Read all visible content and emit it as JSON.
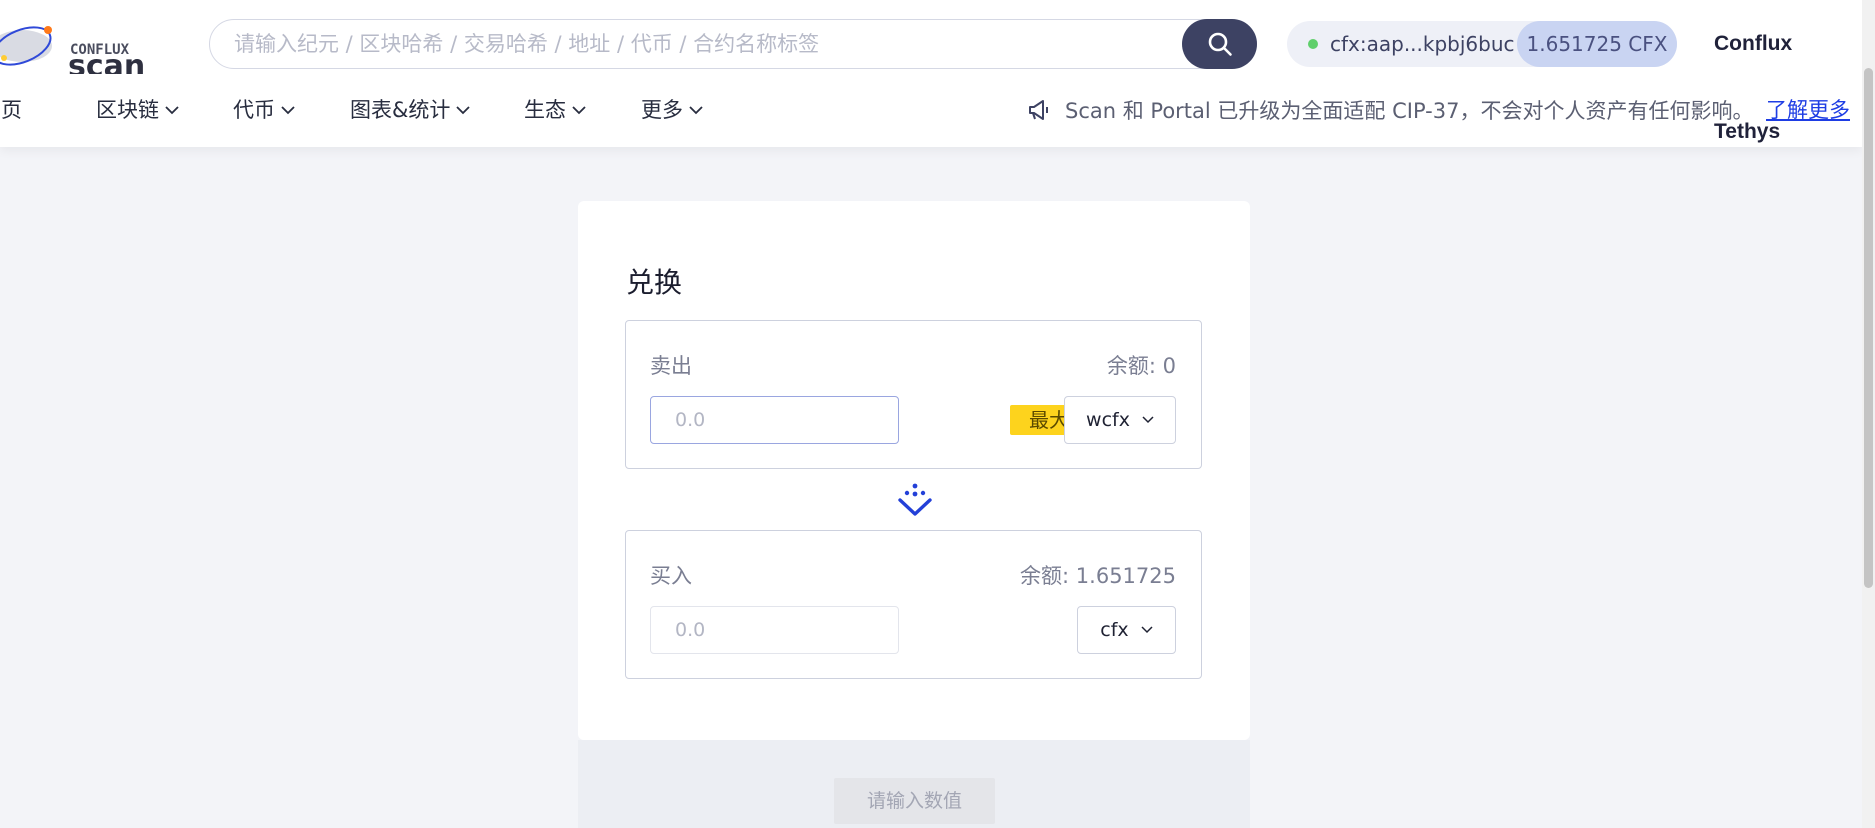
{
  "header": {
    "logo_text_top": "CONFLUX",
    "logo_text_bottom": "scan",
    "search_placeholder": "请输入纪元 / 区块哈希 / 交易哈希 / 地址 / 代币 / 合约名称标签",
    "wallet_address": "cfx:aap...kpbj6buc",
    "wallet_balance": "1.651725 CFX",
    "network": "Conflux Tethys"
  },
  "nav": {
    "items": [
      {
        "label": "首页"
      },
      {
        "label": "区块链"
      },
      {
        "label": "代币"
      },
      {
        "label": "图表&统计"
      },
      {
        "label": "生态"
      },
      {
        "label": "更多"
      }
    ],
    "notice": "Scan 和 Portal 已升级为全面适配 CIP-37，不会对个人资产有任何影响。",
    "learn_more": "了解更多"
  },
  "swap": {
    "title": "兑换",
    "sell": {
      "label": "卖出",
      "balance": "余额: 0",
      "amount_placeholder": "0.0",
      "max_label": "最大",
      "token": "wcfx"
    },
    "buy": {
      "label": "买入",
      "balance": "余额: 1.651725",
      "amount_placeholder": "0.0",
      "token": "cfx"
    },
    "submit_label": "请输入数值"
  },
  "colors": {
    "accent": "#1e3de4",
    "search_button": "#3d4263",
    "max_button": "#fdd31d",
    "wallet_online": "#5fcf6b"
  }
}
